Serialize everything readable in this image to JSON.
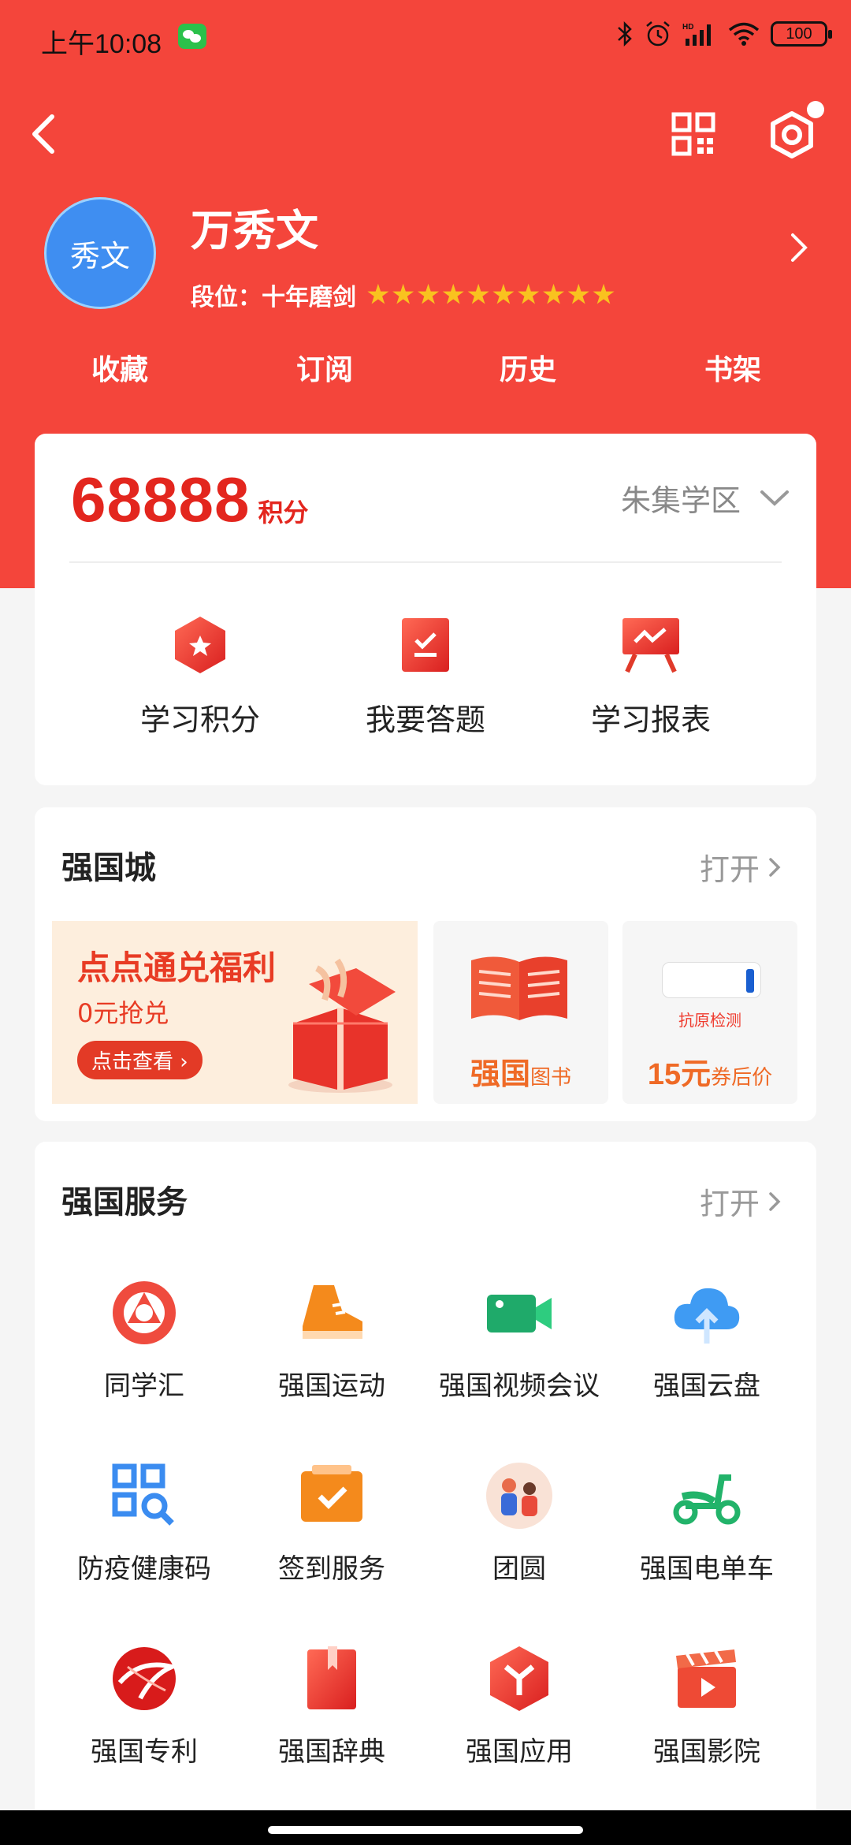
{
  "status_bar": {
    "time": "上午10:08",
    "battery": "100"
  },
  "profile": {
    "avatar_text": "秀文",
    "name": "万秀文",
    "rank_label": "段位：",
    "rank_title": "十年磨剑",
    "stars": 10
  },
  "tabs": [
    "收藏",
    "订阅",
    "历史",
    "书架"
  ],
  "points": {
    "value": "68888",
    "unit": "积分",
    "district": "朱集学区"
  },
  "quick_actions": [
    {
      "label": "学习积分",
      "icon": "star-hexagon-icon"
    },
    {
      "label": "我要答题",
      "icon": "answer-check-icon"
    },
    {
      "label": "学习报表",
      "icon": "report-board-icon"
    }
  ],
  "mall": {
    "title": "强国城",
    "open": "打开",
    "banner": {
      "headline": "点点通兑福利",
      "sub": "0元抢兑",
      "button": "点击查看"
    },
    "books": {
      "big": "强国",
      "small": "图书"
    },
    "kit": {
      "label": "抗原检测",
      "price": "15元",
      "suffix": "券后价"
    }
  },
  "services": {
    "title": "强国服务",
    "open": "打开",
    "items": [
      {
        "label": "同学汇",
        "icon": "classmates-icon"
      },
      {
        "label": "强国运动",
        "icon": "sneaker-icon"
      },
      {
        "label": "强国视频会议",
        "icon": "video-camera-icon"
      },
      {
        "label": "强国云盘",
        "icon": "cloud-upload-icon"
      },
      {
        "label": "防疫健康码",
        "icon": "qr-health-code-icon"
      },
      {
        "label": "签到服务",
        "icon": "check-in-box-icon"
      },
      {
        "label": "团圆",
        "icon": "reunion-icon"
      },
      {
        "label": "强国电单车",
        "icon": "scooter-icon"
      },
      {
        "label": "强国专利",
        "icon": "patent-globe-icon"
      },
      {
        "label": "强国辞典",
        "icon": "dictionary-icon"
      },
      {
        "label": "强国应用",
        "icon": "apps-hexagon-icon"
      },
      {
        "label": "强国影院",
        "icon": "cinema-clapper-icon"
      }
    ]
  },
  "colors": {
    "primary_red": "#f4453b",
    "points_red": "#e3261e",
    "orange": "#ef6a26",
    "star_gold": "#f9c21f"
  }
}
